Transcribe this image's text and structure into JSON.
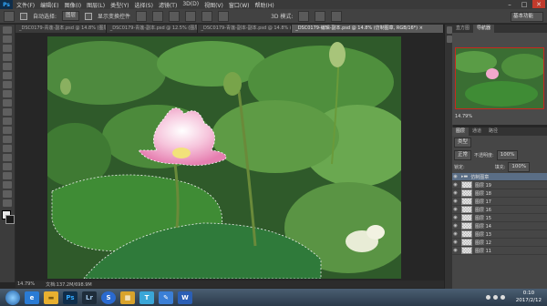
{
  "menubar": {
    "logo": "Ps",
    "items": [
      "文件(F)",
      "编辑(E)",
      "图像(I)",
      "图层(L)",
      "类型(Y)",
      "选择(S)",
      "滤镜(T)",
      "3D(D)",
      "视图(V)",
      "窗口(W)",
      "帮助(H)"
    ],
    "window_controls": [
      "–",
      "□",
      "✕"
    ]
  },
  "options": {
    "auto_select_label": "自动选择:",
    "auto_select_value": "图层",
    "show_transform_label": "显示变换控件",
    "mode_label": "3D 模式:",
    "workspace": "基本功能"
  },
  "tabs": [
    {
      "label": "_DSC0179-青莲-副本.psd @ 14.8% (图层1...",
      "active": false
    },
    {
      "label": "_DSC0179-青莲-副本.psd @ 12.5% (图层...",
      "active": false
    },
    {
      "label": "_DSC0179-青莲-副本-副本.psd @ 14.8% (选...",
      "active": false
    },
    {
      "label": "_DSC0179-编辑-副本.psd @ 14.8% (仿制图章, RGB/16*) ×",
      "active": true
    }
  ],
  "status": {
    "zoom": "14.79%",
    "doc": "文档:137.2M/698.9M"
  },
  "nav": {
    "tabs": [
      "直方图",
      "导航器"
    ],
    "zoom": "14.79%"
  },
  "layers": {
    "tabs": [
      "图层",
      "通道",
      "路径"
    ],
    "kind_label": "类型",
    "blend_mode": "正常",
    "opacity_label": "不透明度:",
    "opacity_value": "100%",
    "lock_label": "锁定:",
    "fill_label": "填充:",
    "fill_value": "100%",
    "group_name": "仿制图章",
    "items": [
      "图层 19",
      "图层 18",
      "图层 17",
      "图层 16",
      "图层 15",
      "图层 14",
      "图层 13",
      "图层 12",
      "图层 11"
    ]
  },
  "taskbar": {
    "apps": [
      {
        "name": "ie-icon",
        "label": "e",
        "color": "#2a7bd4"
      },
      {
        "name": "folder-icon",
        "label": "▬",
        "color": "#e8b030"
      },
      {
        "name": "photoshop-icon",
        "label": "Ps",
        "color": "#0f2d4a"
      },
      {
        "name": "lightroom-icon",
        "label": "Lr",
        "color": "#1e2c3a"
      },
      {
        "name": "browser-icon",
        "label": "S",
        "color": "#2a6ad0"
      },
      {
        "name": "explorer-icon",
        "label": "▦",
        "color": "#d9a32c"
      },
      {
        "name": "font-icon",
        "label": "T",
        "color": "#3aa6d8"
      },
      {
        "name": "pen-icon",
        "label": "✎",
        "color": "#3b7fd6"
      },
      {
        "name": "word-icon",
        "label": "W",
        "color": "#2b5fb5"
      }
    ],
    "time": "0:10",
    "date": "2017/2/12"
  }
}
